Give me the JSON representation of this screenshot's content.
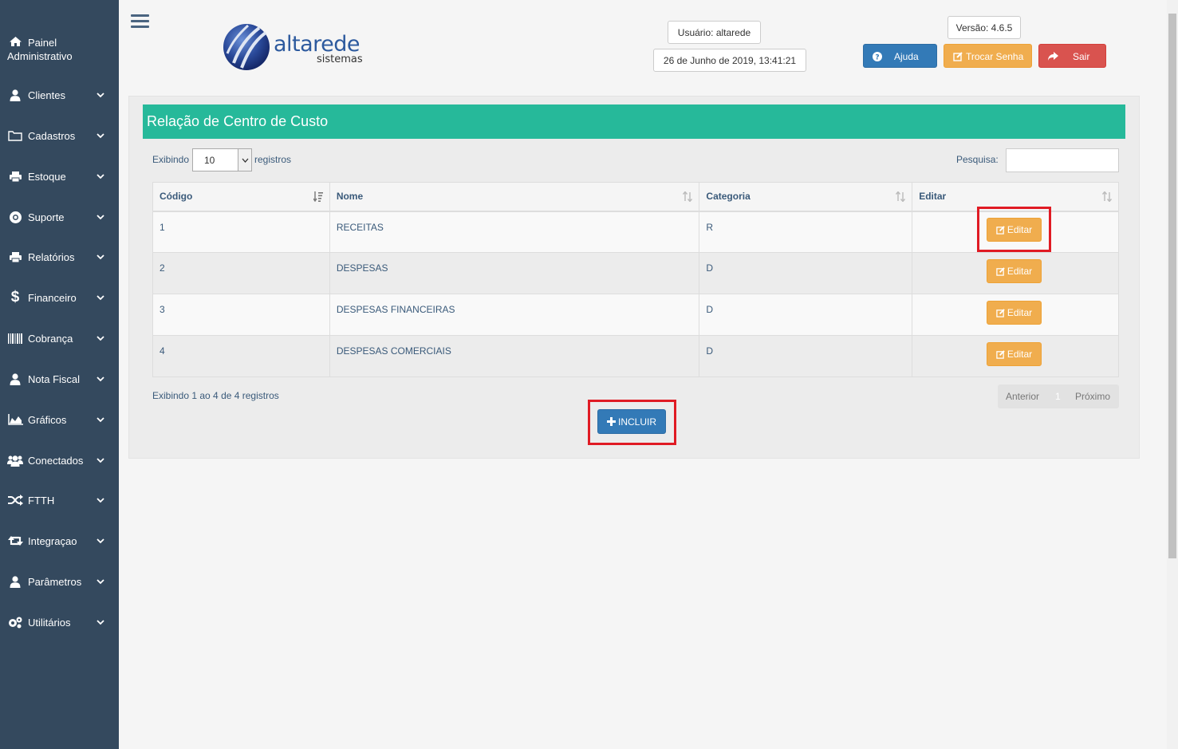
{
  "sidebar": {
    "items": [
      {
        "label_line1": "Painel",
        "label_line2": "Administrativo",
        "icon": "home-icon"
      },
      {
        "label": "Clientes",
        "icon": "user-icon"
      },
      {
        "label": "Cadastros",
        "icon": "folder-icon"
      },
      {
        "label": "Estoque",
        "icon": "printer-icon"
      },
      {
        "label": "Suporte",
        "icon": "lifebuoy-icon"
      },
      {
        "label": "Relatórios",
        "icon": "printer-icon"
      },
      {
        "label": "Financeiro",
        "icon": "dollar-icon"
      },
      {
        "label": "Cobrança",
        "icon": "barcode-icon"
      },
      {
        "label": "Nota Fiscal",
        "icon": "user-icon"
      },
      {
        "label": "Gráficos",
        "icon": "area-chart-icon"
      },
      {
        "label": "Conectados",
        "icon": "users-icon"
      },
      {
        "label": "FTTH",
        "icon": "random-icon"
      },
      {
        "label": "Integraçao",
        "icon": "retweet-icon"
      },
      {
        "label": "Parâmetros",
        "icon": "user-icon"
      },
      {
        "label": "Utilitários",
        "icon": "cogs-icon"
      }
    ]
  },
  "header": {
    "logo_text": "altarede",
    "logo_sub": "sistemas",
    "user": "Usuário: altarede",
    "datetime": "26 de Junho de 2019, 13:41:21",
    "version": "Versão: 4.6.5",
    "help_label": "Ajuda",
    "change_password_label": "Trocar Senha",
    "logout_label": "Sair"
  },
  "panel": {
    "title": "Relação de Centro de Custo",
    "length_prefix": "Exibindo",
    "length_value": "10",
    "length_suffix": "registros",
    "search_label": "Pesquisa:",
    "columns": [
      "Código",
      "Nome",
      "Categoria",
      "Editar"
    ],
    "rows": [
      {
        "codigo": "1",
        "nome": "RECEITAS",
        "categoria": "R",
        "action": "Editar"
      },
      {
        "codigo": "2",
        "nome": "DESPESAS",
        "categoria": "D",
        "action": "Editar"
      },
      {
        "codigo": "3",
        "nome": "DESPESAS FINANCEIRAS",
        "categoria": "D",
        "action": "Editar"
      },
      {
        "codigo": "4",
        "nome": "DESPESAS COMERCIAIS",
        "categoria": "D",
        "action": "Editar"
      }
    ],
    "info": "Exibindo 1 ao 4 de 4 registros",
    "pager": {
      "prev": "Anterior",
      "page": "1",
      "next": "Próximo"
    },
    "add_label": "INCLUIR"
  },
  "colors": {
    "sidebar": "#34495e",
    "panel_header": "#26b99a",
    "primary": "#337ab7",
    "warning": "#f0ad4e",
    "danger": "#d9534f",
    "highlight": "#e01b24"
  }
}
